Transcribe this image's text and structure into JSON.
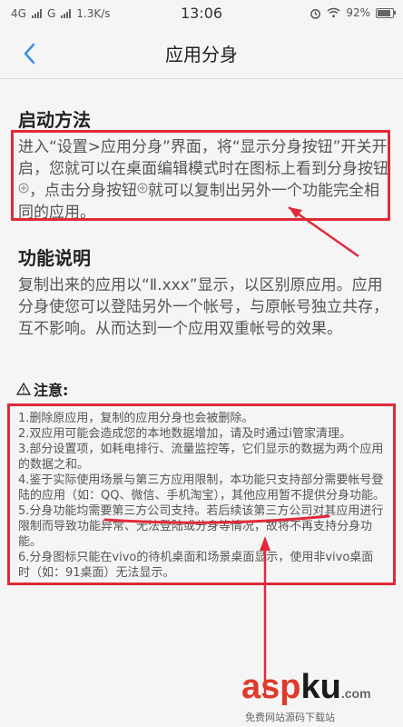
{
  "status_bar": {
    "network_1": "4G",
    "network_2": "G",
    "speed": "1.3K/s",
    "time": "13:06",
    "battery": "92%",
    "battery_level": 0.92
  },
  "nav": {
    "title": "应用分身",
    "back_icon": "chevron-left-icon"
  },
  "startup": {
    "title": "启动方法",
    "text_part1": "进入“设置>应用分身”界面，将“显示分身按钮”开关开启，您就可以在桌面编辑模式时在图标上看到分身按钮",
    "text_part2": "，点击分身按钮",
    "text_part3": "就可以复制出另外一个功能完全相同的应用。"
  },
  "features": {
    "title": "功能说明",
    "text": "复制出来的应用以“Ⅱ.xxx”显示，以区别原应用。应用分身使您可以登陆另外一个帐号，与原帐号独立共存，互不影响。从而达到一个应用双重帐号的效果。"
  },
  "notice": {
    "title": "注意:",
    "items": [
      "1.删除原应用，复制的应用分身也会被删除。",
      "2.双应用可能会造成您的本地数据增加，请及时通过i管家清理。",
      "3.部分设置项，如耗电排行、流量监控等，它们显示的数据为两个应用的数据之和。",
      "4.鉴于实际使用场景与第三方应用限制，本功能只支持部分需要帐号登陆的应用（如：QQ、微信、手机淘宝），其他应用暂不提供分身功能。",
      "5.分身功能均需要第三方公司支持。若后续该第三方公司对其应用进行限制而导致功能异常、无法登陆或分身等情况，故将不再支持分身功能。",
      "6.分身图标只能在vivo的待机桌面和场景桌面显示，使用非vivo桌面时（如：91桌面）无法显示。"
    ]
  },
  "watermark": {
    "brand_a": "asp",
    "brand_b": "ku",
    "brand_c": ".com",
    "sub": "免费网站源码下载站"
  },
  "colors": {
    "annotation_red": "#e02a3a",
    "accent_blue": "#3a8fe0"
  }
}
